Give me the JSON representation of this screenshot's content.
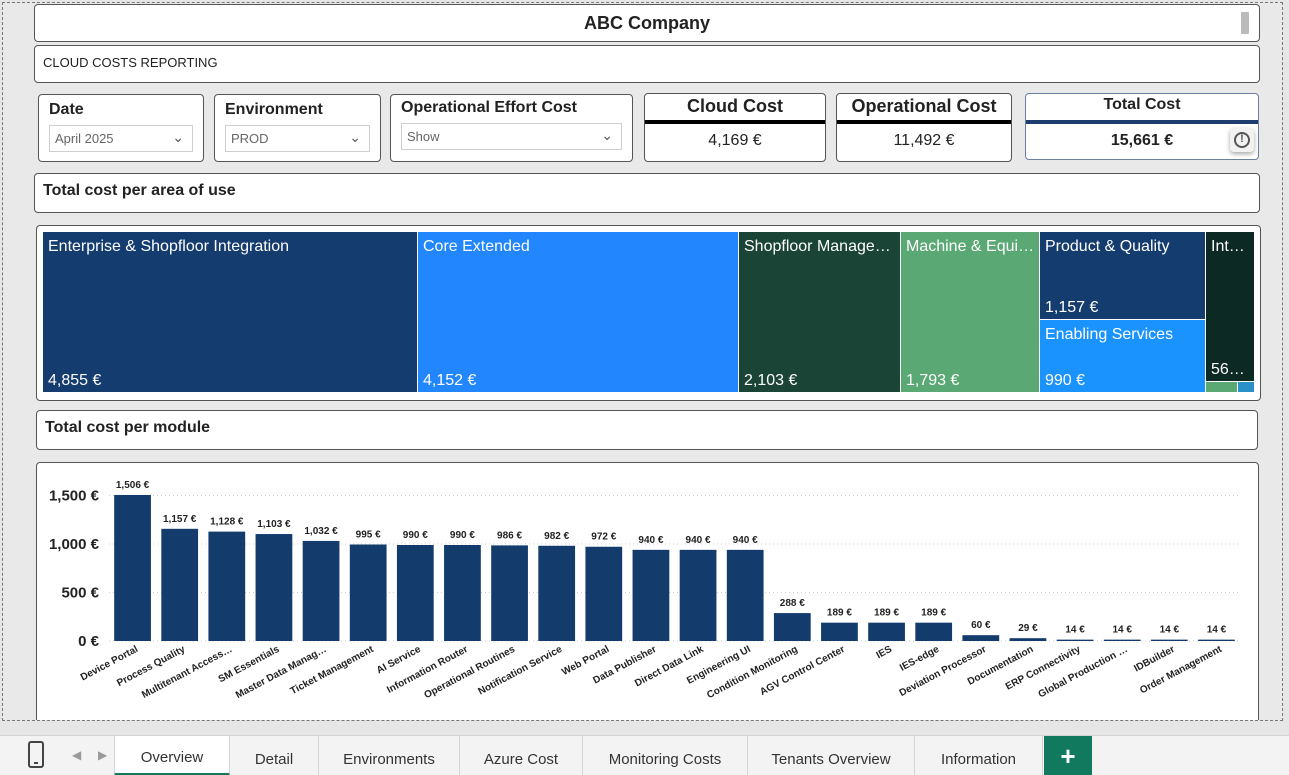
{
  "header": {
    "title": "ABC Company",
    "subtitle": "CLOUD COSTS REPORTING"
  },
  "filters": [
    {
      "label": "Date",
      "value": "April 2025"
    },
    {
      "label": "Environment",
      "value": "PROD"
    },
    {
      "label": "Operational Effort Cost",
      "value": "Show"
    }
  ],
  "kpis": {
    "cloud": {
      "title": "Cloud Cost",
      "value": "4,169 €"
    },
    "operational": {
      "title": "Operational Cost",
      "value": "11,492 €"
    },
    "total": {
      "title": "Total Cost",
      "value": "15,661 €"
    }
  },
  "sections": {
    "area": "Total cost per area of use",
    "module": "Total cost per module"
  },
  "treemap": [
    {
      "name": "Enterprise & Shopfloor Integration",
      "value": "4,855 €",
      "color": "#143c6e"
    },
    {
      "name": "Core Extended",
      "value": "4,152 €",
      "color": "#2287ff"
    },
    {
      "name": "Shopfloor Manage…",
      "value": "2,103 €",
      "color": "#1a4436"
    },
    {
      "name": "Machine & Equi…",
      "value": "1,793 €",
      "color": "#5aa874"
    },
    {
      "name": "Product & Quality",
      "value": "1,157 €",
      "color": "#143c6e"
    },
    {
      "name": "Enabling Services",
      "value": "990 €",
      "color": "#1a93ff"
    },
    {
      "name": "Int…",
      "value": "56…",
      "color": "#0d2923"
    }
  ],
  "treemap_colors": {
    "small1": "#5aa874",
    "small2": "#2a90c8"
  },
  "chart_data": {
    "type": "bar",
    "categories": [
      "Device Portal",
      "Process Quality",
      "Multitenant Access…",
      "SM Essentials",
      "Master Data Manag…",
      "Ticket Management",
      "AI Service",
      "Information Router",
      "Operational Routines",
      "Notification Service",
      "Web Portal",
      "Data Publisher",
      "Direct Data Link",
      "Engineering UI",
      "Condition Monitoring",
      "AGV Control Center",
      "IES",
      "IES-edge",
      "Deviation Processor",
      "Documentation",
      "ERP Connectivity",
      "Global Production …",
      "IDBuilder",
      "Order Management"
    ],
    "values": [
      1506,
      1157,
      1128,
      1103,
      1032,
      995,
      990,
      990,
      986,
      982,
      972,
      940,
      940,
      940,
      288,
      189,
      189,
      189,
      60,
      29,
      14,
      14,
      14,
      14
    ],
    "labels": [
      "1,506 €",
      "1,157 €",
      "1,128 €",
      "1,103 €",
      "1,032 €",
      "995 €",
      "990 €",
      "990 €",
      "986 €",
      "982 €",
      "972 €",
      "940 €",
      "940 €",
      "940 €",
      "288 €",
      "189 €",
      "189 €",
      "189 €",
      "60 €",
      "29 €",
      "14 €",
      "14 €",
      "14 €",
      "14 €"
    ],
    "yticks": [
      "0 €",
      "500 €",
      "1,000 €",
      "1,500 €"
    ],
    "ytick_values": [
      0,
      500,
      1000,
      1500
    ],
    "ylim": [
      0,
      1650
    ],
    "bar_color": "#133c6d",
    "title": "",
    "xlabel": "",
    "ylabel": ""
  },
  "tabs": [
    "Overview",
    "Detail",
    "Environments",
    "Azure Cost",
    "Monitoring Costs",
    "Tenants Overview",
    "Information"
  ],
  "add_tab_label": "+",
  "active_tab": "Overview"
}
